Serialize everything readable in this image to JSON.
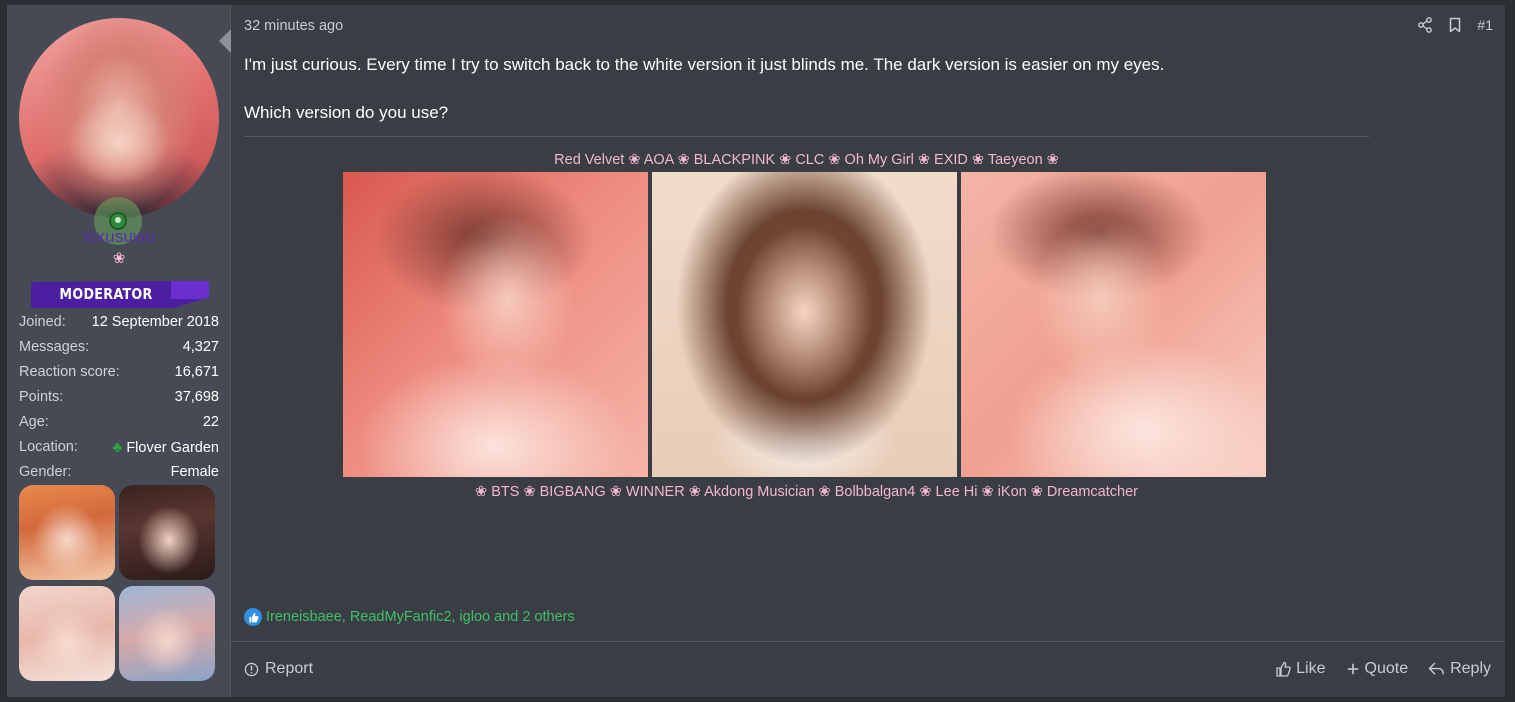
{
  "user": {
    "username": "lexusuwu",
    "flower": "❀",
    "banner": "Moderator",
    "stats": [
      {
        "label": "Joined:",
        "value": "12 September 2018"
      },
      {
        "label": "Messages:",
        "value": "4,327"
      },
      {
        "label": "Reaction score:",
        "value": "16,671"
      },
      {
        "label": "Points:",
        "value": "37,698"
      },
      {
        "label": "Age:",
        "value": "22"
      },
      {
        "label": "Location:",
        "value": "Flover Garden"
      },
      {
        "label": "Gender:",
        "value": "Female"
      }
    ]
  },
  "post": {
    "timestamp": "32 minutes ago",
    "number": "#1",
    "paragraphs": [
      "I'm just curious. Every time I try to switch back to the white version it just blinds me. The dark version is easier on my eyes.",
      "Which version do you use?"
    ],
    "signature_top": "Red Velvet ❀ AOA ❀ BLACKPINK ❀ CLC ❀ Oh My Girl ❀ EXID ❀ Taeyeon ❀",
    "signature_bottom": "❀ BTS ❀ BIGBANG ❀ WINNER ❀ Akdong Musician ❀ Bolbbalgan4 ❀ Lee Hi ❀ iKon ❀ Dreamcatcher",
    "reactions": "Ireneisbaee, ReadMyFanfic2, igloo and 2 others"
  },
  "actions": {
    "report": "Report",
    "like": "Like",
    "quote": "Quote",
    "reply": "Reply"
  },
  "icons": [
    "share-icon",
    "bookmark-icon",
    "info-icon",
    "thumbs-up-icon",
    "plus-icon",
    "reply-icon",
    "clover-icon"
  ],
  "colors": {
    "username": "#5a2ea8",
    "banner": "#4b1fa0",
    "reaction_link": "#3fbf6a",
    "signature": "#f2b9cc",
    "background": "#3a3d44",
    "sidebar": "#464a54"
  }
}
